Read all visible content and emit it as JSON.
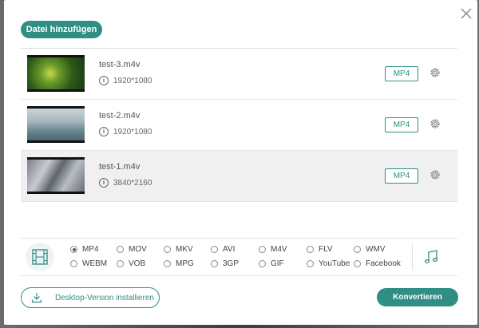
{
  "dialog": {
    "add_button": "Datei hinzufügen",
    "close_icon": "close-icon"
  },
  "files": [
    {
      "name": "test-3.m4v",
      "resolution": "1920*1080",
      "format": "MP4",
      "selected": false,
      "thumb": "green meadow"
    },
    {
      "name": "test-2.m4v",
      "resolution": "1920*1080",
      "format": "MP4",
      "selected": false,
      "thumb": "sea"
    },
    {
      "name": "test-1.m4v",
      "resolution": "3840*2160",
      "format": "MP4",
      "selected": true,
      "thumb": "snowy forest aerial"
    }
  ],
  "formats": {
    "selected": "MP4",
    "options": [
      "MP4",
      "MOV",
      "MKV",
      "AVI",
      "M4V",
      "FLV",
      "WMV",
      "WEBM",
      "VOB",
      "MPG",
      "3GP",
      "GIF",
      "YouTube",
      "Facebook"
    ]
  },
  "footer": {
    "desktop_button": "Desktop-Version installieren",
    "convert_button": "Konvertieren"
  },
  "colors": {
    "accent": "#2f8f84"
  }
}
